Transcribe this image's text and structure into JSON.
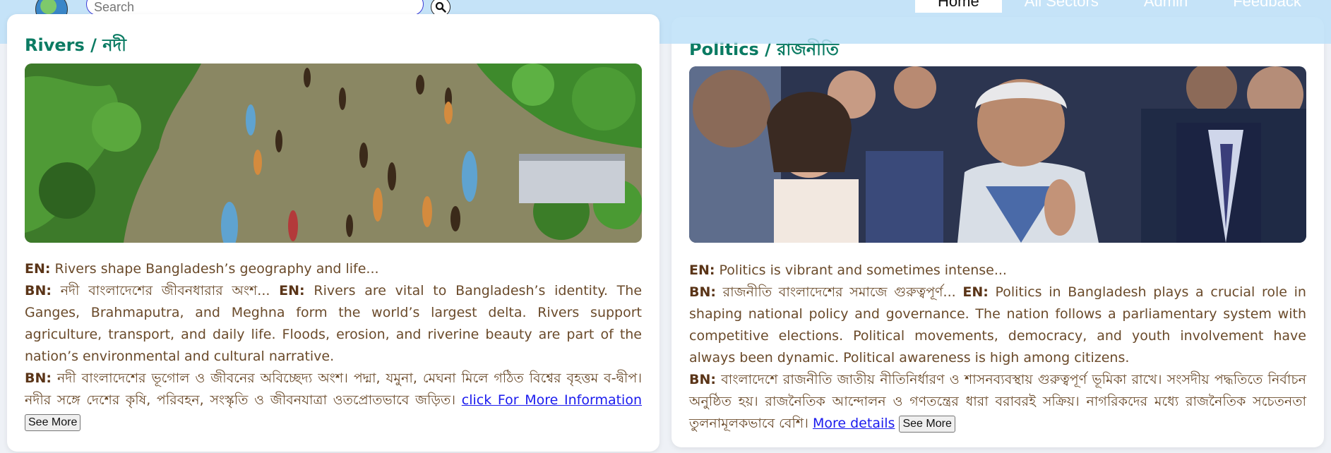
{
  "header": {
    "search_placeholder": "Search",
    "nav": [
      {
        "label": "Home",
        "active": true
      },
      {
        "label": "All Sectors",
        "active": false
      },
      {
        "label": "Admin",
        "active": false
      },
      {
        "label": "Feedback",
        "active": false
      }
    ]
  },
  "cards": [
    {
      "title": "Rivers / নদী",
      "summary_en_label": "EN:",
      "summary_en": "Rivers shape Bangladesh’s geography and life...",
      "bn_label": "BN:",
      "bn_intro": "নদী বাংলাদেশের জীবনধারার অংশ...",
      "en_label": "EN:",
      "en_detail": "Rivers are vital to Bangladesh’s identity. The Ganges, Brahmaputra, and Meghna form the world’s largest delta. Rivers support agriculture, transport, and daily life. Floods, erosion, and riverine beauty are part of the nation’s environmental and cultural narrative.",
      "bn_label_2": "BN:",
      "bn_detail": "নদী বাংলাদেশের ভূগোল ও জীবনের অবিচ্ছেদ্য অংশ। পদ্মা, যমুনা, মেঘনা মিলে গঠিত বিশ্বের বৃহত্তম ব-দ্বীপ। নদীর সঙ্গে দেশের কৃষি, পরিবহন, সংস্কৃতি ও জীবনযাত্রা ওতপ্রোতভাবে জড়িত।",
      "link_text": "click For More Information",
      "see_more": "See More"
    },
    {
      "title": "Politics / রাজনীতি",
      "summary_en_label": "EN:",
      "summary_en": "Politics is vibrant and sometimes intense...",
      "bn_label": "BN:",
      "bn_intro": "রাজনীতি বাংলাদেশের সমাজে গুরুত্বপূর্ণ...",
      "en_label": "EN:",
      "en_detail": "Politics in Bangladesh plays a crucial role in shaping national policy and governance. The nation follows a parliamentary system with competitive elections. Political movements, democracy, and youth involvement have always been dynamic. Political awareness is high among citizens.",
      "bn_label_2": "BN:",
      "bn_detail": "বাংলাদেশে রাজনীতি জাতীয় নীতিনির্ধারণ ও শাসনব্যবস্থায় গুরুত্বপূর্ণ ভূমিকা রাখে। সংসদীয় পদ্ধতিতে নির্বাচন অনুষ্ঠিত হয়। রাজনৈতিক আন্দোলন ও গণতন্ত্রের ধারা বরাবরই সক্রিয়। নাগরিকদের মধ্যে রাজনৈতিক সচেতনতা তুলনামূলকভাবে বেশি।",
      "link_text": "More details",
      "see_more": "See More"
    }
  ],
  "colors": {
    "title_green": "#0b7b63",
    "body_brown": "#6a4a2a",
    "link_blue": "#1a1aee",
    "topbar": "#bde0f8"
  }
}
